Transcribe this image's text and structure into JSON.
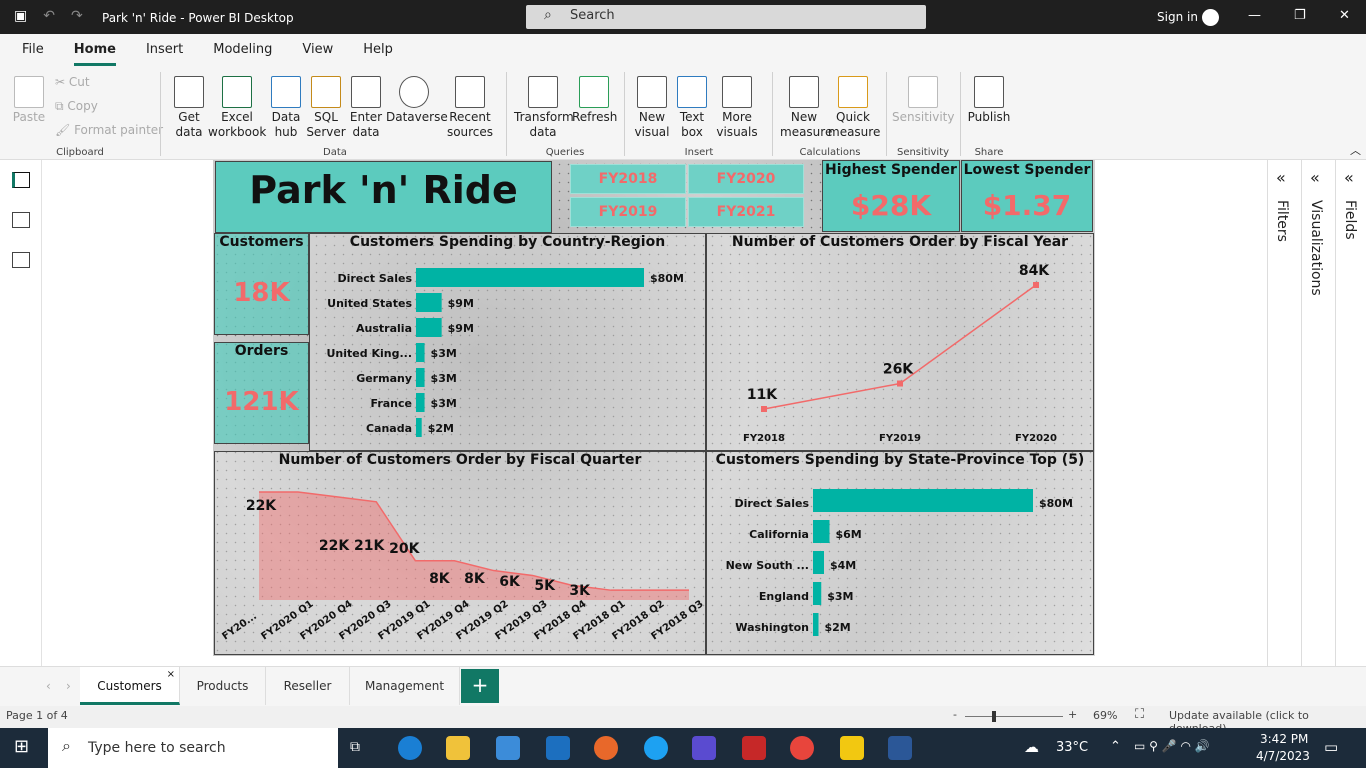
{
  "window": {
    "title": "Park 'n' Ride - Power BI Desktop",
    "search_placeholder": "Search",
    "signin": "Sign in"
  },
  "menu": [
    {
      "label": "File"
    },
    {
      "label": "Home",
      "active": true
    },
    {
      "label": "Insert"
    },
    {
      "label": "Modeling"
    },
    {
      "label": "View"
    },
    {
      "label": "Help"
    }
  ],
  "ribbon": {
    "clipboard": {
      "paste": "Paste",
      "cut": "Cut",
      "copy": "Copy",
      "format_painter": "Format painter",
      "group": "Clipboard"
    },
    "data": {
      "get_data": "Get data",
      "excel": "Excel workbook",
      "data_hub": "Data hub",
      "sql": "SQL Server",
      "enter_data": "Enter data",
      "dataverse": "Dataverse",
      "recent": "Recent sources",
      "group": "Data"
    },
    "queries": {
      "transform": "Transform data",
      "refresh": "Refresh",
      "group": "Queries"
    },
    "insert": {
      "new_visual": "New visual",
      "text_box": "Text box",
      "more_visuals": "More visuals",
      "group": "Insert"
    },
    "calculations": {
      "new_measure": "New measure",
      "quick_measure": "Quick measure",
      "group": "Calculations"
    },
    "sensitivity": {
      "label": "Sensitivity",
      "group": "Sensitivity"
    },
    "share": {
      "publish": "Publish",
      "group": "Share"
    }
  },
  "report": {
    "title": "Park 'n' Ride",
    "fy_buttons": [
      "FY2018",
      "FY2020",
      "FY2019",
      "FY2021"
    ],
    "highest": {
      "label": "Highest Spender",
      "value": "$28K"
    },
    "lowest": {
      "label": "Lowest Spender",
      "value": "$1.37"
    },
    "customers": {
      "label": "Customers",
      "value": "18K"
    },
    "orders": {
      "label": "Orders",
      "value": "121K"
    },
    "accent": "#00b3a4",
    "kpi_color": "#f26a6a"
  },
  "chart_data": [
    {
      "type": "bar",
      "title": "Customers Spending by Country-Region",
      "categories": [
        "Direct Sales",
        "United States",
        "Australia",
        "United King...",
        "Germany",
        "France",
        "Canada"
      ],
      "values": [
        80,
        9,
        9,
        3,
        3,
        3,
        2
      ],
      "labels": [
        "$80M",
        "$9M",
        "$9M",
        "$3M",
        "$3M",
        "$3M",
        "$2M"
      ]
    },
    {
      "type": "line",
      "title": "Number of Customers Order by Fiscal Year",
      "categories": [
        "FY2018",
        "FY2019",
        "FY2020"
      ],
      "values": [
        11,
        26,
        84
      ],
      "labels": [
        "11K",
        "26K",
        "84K"
      ]
    },
    {
      "type": "area",
      "title": "Number of Customers Order by Fiscal Quarter",
      "categories": [
        "FY20...",
        "FY2020 Q1",
        "FY2020 Q4",
        "FY2020 Q3",
        "FY2019 Q1",
        "FY2019 Q4",
        "FY2019 Q2",
        "FY2019 Q3",
        "FY2018 Q4",
        "FY2018 Q1",
        "FY2018 Q2",
        "FY2018 Q3"
      ],
      "values": [
        22,
        22,
        21,
        20,
        8,
        8,
        6,
        5,
        3,
        2,
        2,
        2
      ],
      "labels": [
        "22K",
        "22K",
        "21K",
        "20K",
        "8K",
        "8K",
        "6K",
        "5K",
        "3K",
        "",
        "",
        ""
      ]
    },
    {
      "type": "bar",
      "title": "Customers Spending by State-Province Top (5)",
      "categories": [
        "Direct Sales",
        "California",
        "New South ...",
        "England",
        "Washington"
      ],
      "values": [
        80,
        6,
        4,
        3,
        2
      ],
      "labels": [
        "$80M",
        "$6M",
        "$4M",
        "$3M",
        "$2M"
      ]
    }
  ],
  "side_panes": [
    "Filters",
    "Visualizations",
    "Fields"
  ],
  "pages": [
    {
      "label": "Customers",
      "active": true
    },
    {
      "label": "Products"
    },
    {
      "label": "Reseller"
    },
    {
      "label": "Management"
    }
  ],
  "status": {
    "page": "Page 1 of 4",
    "zoom": "69%",
    "update": "Update available (click to download)"
  },
  "taskbar": {
    "search": "Type here to search",
    "weather": "33°C",
    "time": "3:42 PM",
    "date": "4/7/2023"
  }
}
